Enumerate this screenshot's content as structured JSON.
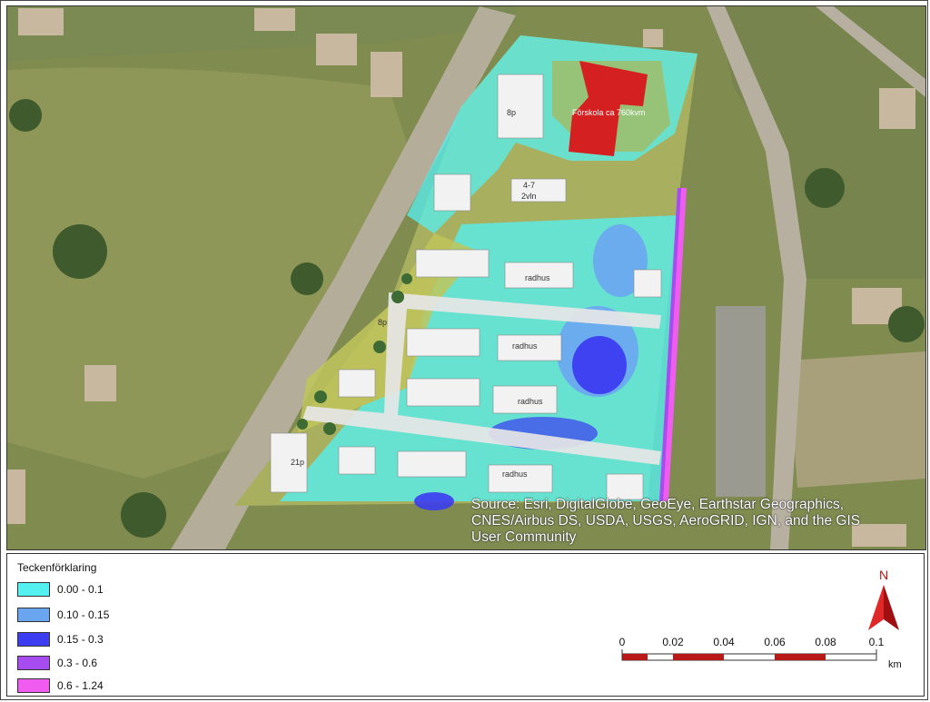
{
  "map": {
    "attribution_lines": [
      "Source: Esri, DigitalGlobe, GeoEye, Earthstar Geographics,",
      "CNES/Airbus DS, USDA, USGS, AeroGRID, IGN, and the GIS",
      "User Community"
    ],
    "site_labels": [
      "8p",
      "radhus",
      "radhus",
      "radhus",
      "radhus",
      "8p",
      "21p",
      "4-7",
      "2vln",
      "Förskola ca 760kvm"
    ],
    "colors": {
      "grass": "#8a9456",
      "field": "#7e8950",
      "road": "#b7b1a0",
      "building_red": "#d42020"
    }
  },
  "legend": {
    "title": "Teckenförklaring",
    "classes": [
      {
        "label": "0.00 - 0.1",
        "color": "#55f0f0"
      },
      {
        "label": "0.10 - 0.15",
        "color": "#6aa6f0"
      },
      {
        "label": "0.15 - 0.3",
        "color": "#3c3cf0"
      },
      {
        "label": "0.3 - 0.6",
        "color": "#a64cf0"
      },
      {
        "label": "0.6 - 1.24",
        "color": "#f05cf0"
      }
    ]
  },
  "north_arrow": {
    "label": "N",
    "icon": "north-arrow-icon",
    "color": "#c01010"
  },
  "scale_bar": {
    "ticks": [
      "0",
      "0.02",
      "0.04",
      "0.06",
      "0.08",
      "0.1"
    ],
    "unit": "km"
  }
}
